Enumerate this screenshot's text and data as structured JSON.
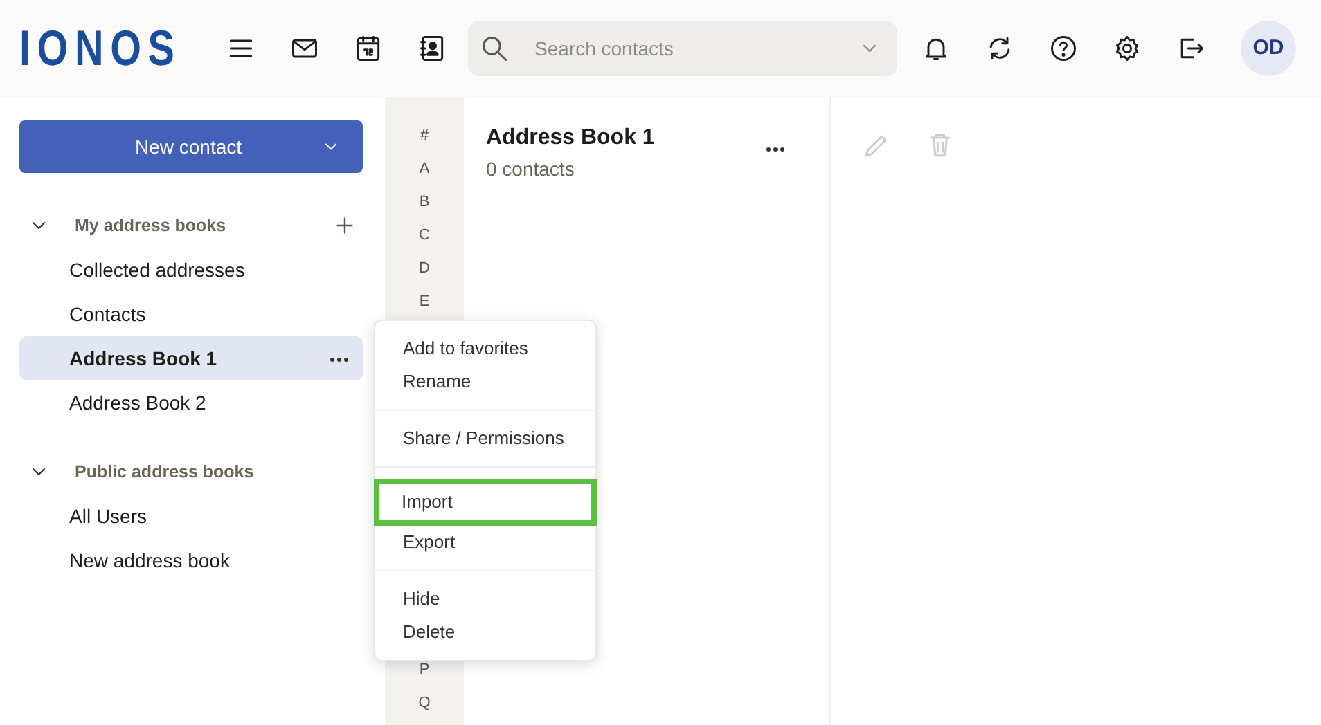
{
  "header": {
    "logo": "IONOS",
    "search": {
      "placeholder": "Search contacts"
    },
    "avatar": "OD"
  },
  "sidebar": {
    "new_button": "New contact",
    "sections": [
      {
        "title": "My address books",
        "expanded": true,
        "items": [
          {
            "label": "Collected addresses",
            "selected": false
          },
          {
            "label": "Contacts",
            "selected": false
          },
          {
            "label": "Address Book 1",
            "selected": true
          },
          {
            "label": "Address Book 2",
            "selected": false
          }
        ]
      },
      {
        "title": "Public address books",
        "expanded": true,
        "items": [
          {
            "label": "All Users",
            "selected": false
          },
          {
            "label": "New address book",
            "selected": false
          }
        ]
      }
    ]
  },
  "index_letters_top": [
    "#",
    "A",
    "B",
    "C",
    "D",
    "E"
  ],
  "index_letters_bottom": [
    "P",
    "Q"
  ],
  "list": {
    "title": "Address Book 1",
    "subtitle": "0 contacts"
  },
  "context_menu": {
    "groups": [
      [
        {
          "label": "Add to favorites",
          "highlighted": false
        },
        {
          "label": "Rename",
          "highlighted": false
        }
      ],
      [
        {
          "label": "Share / Permissions",
          "highlighted": false
        }
      ],
      [
        {
          "label": "Import",
          "highlighted": true
        },
        {
          "label": "Export",
          "highlighted": false
        }
      ],
      [
        {
          "label": "Hide",
          "highlighted": false
        },
        {
          "label": "Delete",
          "highlighted": false
        }
      ]
    ]
  }
}
